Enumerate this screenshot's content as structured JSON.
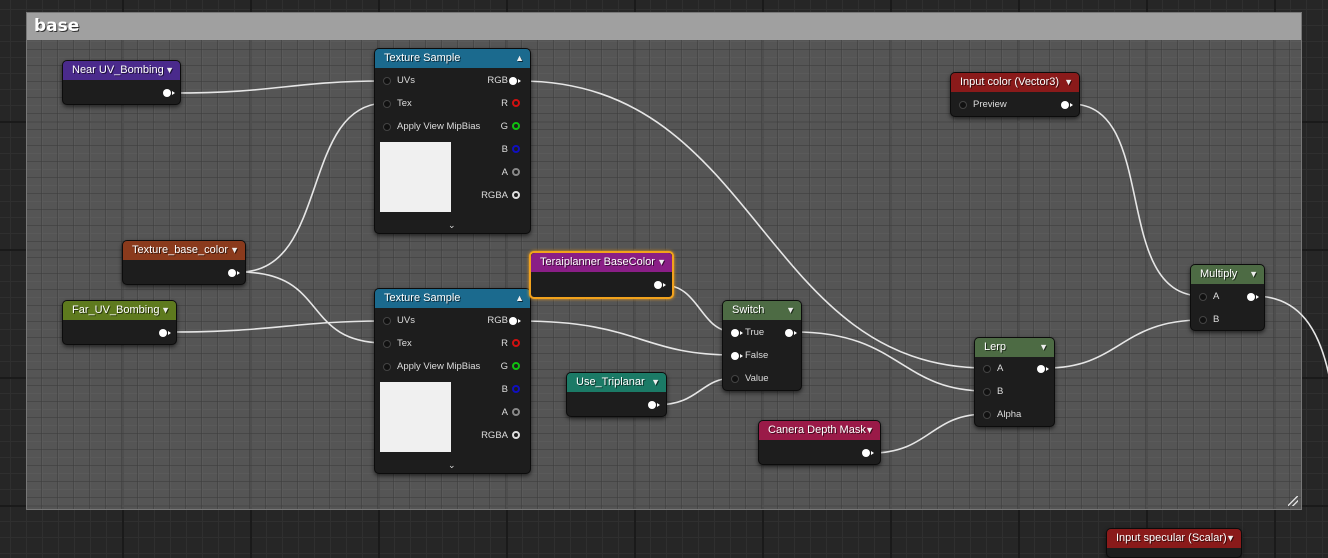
{
  "comment": {
    "title": "base"
  },
  "nodes": {
    "near_uv": {
      "title": "Near UV_Bombing",
      "color": "#4a2a8c"
    },
    "tex_base_color": {
      "title": "Texture_base_color",
      "color": "#8a3a1c"
    },
    "far_uv": {
      "title": "Far_UV_Bombing",
      "color": "#5e7a1e"
    },
    "tex_sample_1": {
      "title": "Texture Sample",
      "color": "#1b6a8e",
      "in_uvs": "UVs",
      "in_tex": "Tex",
      "in_mip": "Apply View MipBias",
      "out_rgb": "RGB",
      "out_r": "R",
      "out_g": "G",
      "out_b": "B",
      "out_a": "A",
      "out_rgba": "RGBA"
    },
    "tex_sample_2": {
      "title": "Texture Sample",
      "color": "#1b6a8e",
      "in_uvs": "UVs",
      "in_tex": "Tex",
      "in_mip": "Apply View MipBias",
      "out_rgb": "RGB",
      "out_r": "R",
      "out_g": "G",
      "out_b": "B",
      "out_a": "A",
      "out_rgba": "RGBA"
    },
    "terai": {
      "title": "Teraiplanner BaseColor",
      "color": "#8a1e86"
    },
    "switch": {
      "title": "Switch",
      "color": "#4d6b44",
      "in_true": "True",
      "in_false": "False",
      "in_value": "Value"
    },
    "use_triplanar": {
      "title": "Use_Triplanar",
      "color": "#1b7a66"
    },
    "lerp": {
      "title": "Lerp",
      "color": "#4d6b44",
      "in_a": "A",
      "in_b": "B",
      "in_alpha": "Alpha"
    },
    "camera_depth": {
      "title": "Canera Depth Mask",
      "color": "#9a1a48"
    },
    "input_color": {
      "title": "Input color (Vector3)",
      "color": "#8a1a1a",
      "in_preview": "Preview"
    },
    "multiply": {
      "title": "Multiply",
      "color": "#4d6b44",
      "in_a": "A",
      "in_b": "B"
    },
    "input_specular": {
      "title": "Input specular (Scalar)",
      "color": "#8a1a1a"
    }
  },
  "icons": {
    "dropdown": "chevron-down-icon",
    "collapse": "chevron-up-icon",
    "expand": "chevron-down-icon",
    "output_pin": "exec-pin-icon"
  },
  "pin_colors": {
    "R": "#d01010",
    "G": "#10c010",
    "B": "#1010c0",
    "A": "#888888",
    "white": "#ffffff"
  }
}
